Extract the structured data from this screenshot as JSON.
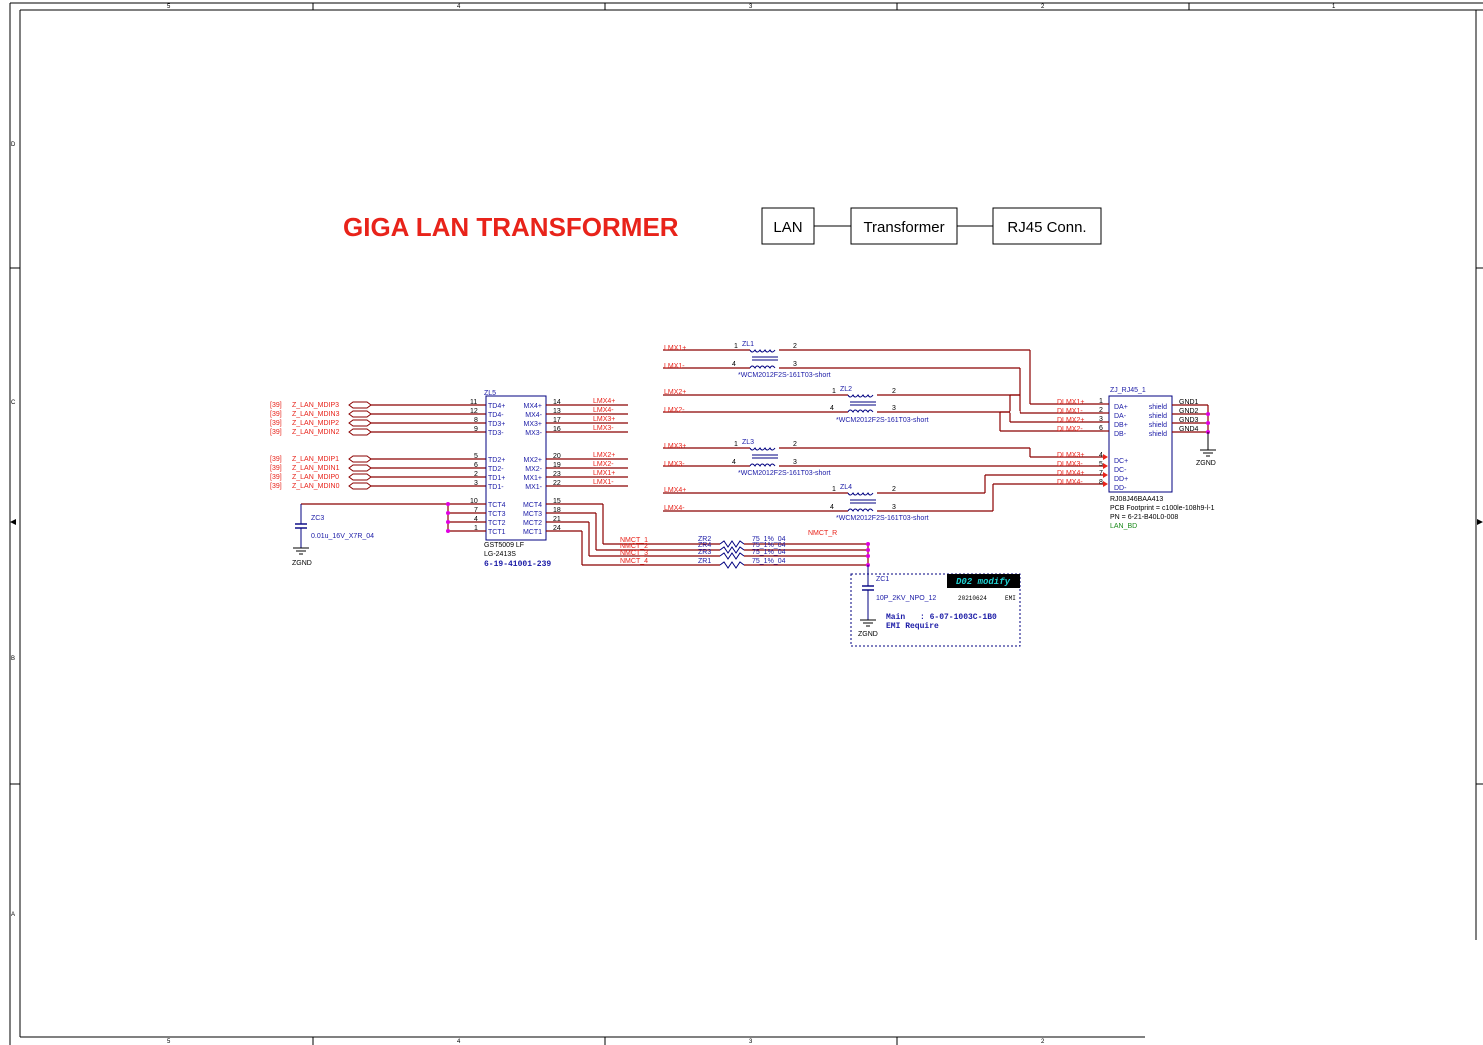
{
  "frame": {
    "top_cols": [
      "5",
      "4",
      "3",
      "2",
      "1"
    ],
    "bottom_cols": [
      "5",
      "4",
      "3",
      "2"
    ],
    "rows": [
      "D",
      "C",
      "B",
      "A"
    ]
  },
  "title": "GIGA LAN TRANSFORMER",
  "block_diagram": [
    "LAN",
    "Transformer",
    "RJ45 Conn."
  ],
  "zl5": {
    "ref": "ZL5",
    "part": "GST5009 LF",
    "alt_part": "LG-2413S",
    "pn": "6-19-41001-239",
    "left_pins": [
      {
        "num": "11",
        "name": "TD4+"
      },
      {
        "num": "12",
        "name": "TD4-"
      },
      {
        "num": "8",
        "name": "TD3+"
      },
      {
        "num": "9",
        "name": "TD3-"
      },
      {
        "num": "5",
        "name": "TD2+"
      },
      {
        "num": "6",
        "name": "TD2-"
      },
      {
        "num": "2",
        "name": "TD1+"
      },
      {
        "num": "3",
        "name": "TD1-"
      },
      {
        "num": "10",
        "name": "TCT4"
      },
      {
        "num": "7",
        "name": "TCT3"
      },
      {
        "num": "4",
        "name": "TCT2"
      },
      {
        "num": "1",
        "name": "TCT1"
      }
    ],
    "right_pins": [
      {
        "num": "14",
        "name": "MX4+"
      },
      {
        "num": "13",
        "name": "MX4-"
      },
      {
        "num": "17",
        "name": "MX3+"
      },
      {
        "num": "16",
        "name": "MX3-"
      },
      {
        "num": "20",
        "name": "MX2+"
      },
      {
        "num": "19",
        "name": "MX2-"
      },
      {
        "num": "23",
        "name": "MX1+"
      },
      {
        "num": "22",
        "name": "MX1-"
      },
      {
        "num": "15",
        "name": "MCT4"
      },
      {
        "num": "18",
        "name": "MCT3"
      },
      {
        "num": "21",
        "name": "MCT2"
      },
      {
        "num": "24",
        "name": "MCT1"
      }
    ]
  },
  "mdi_ports": [
    {
      "sheet": "[39]",
      "net": "Z_LAN_MDIP3"
    },
    {
      "sheet": "[39]",
      "net": "Z_LAN_MDIN3"
    },
    {
      "sheet": "[39]",
      "net": "Z_LAN_MDIP2"
    },
    {
      "sheet": "[39]",
      "net": "Z_LAN_MDIN2"
    },
    {
      "sheet": "[39]",
      "net": "Z_LAN_MDIP1"
    },
    {
      "sheet": "[39]",
      "net": "Z_LAN_MDIN1"
    },
    {
      "sheet": "[39]",
      "net": "Z_LAN_MDIP0"
    },
    {
      "sheet": "[39]",
      "net": "Z_LAN_MDIN0"
    }
  ],
  "zl5_right_nets": [
    "LMX4+",
    "LMX4-",
    "LMX3+",
    "LMX3-",
    "LMX2+",
    "LMX2-",
    "LMX1+",
    "LMX1-"
  ],
  "zc3": {
    "ref": "ZC3",
    "value": "0.01u_16V_X7R_04",
    "gnd": "ZGND"
  },
  "chokes": [
    {
      "ref": "ZL1",
      "in_p": "LMX1+",
      "in_n": "LMX1-",
      "pins": [
        "1",
        "4",
        "2",
        "3"
      ],
      "part": "*WCM2012F2S-161T03-short"
    },
    {
      "ref": "ZL2",
      "in_p": "LMX2+",
      "in_n": "LMX2-",
      "pins": [
        "1",
        "4",
        "2",
        "3"
      ],
      "part": "*WCM2012F2S-161T03-short"
    },
    {
      "ref": "ZL3",
      "in_p": "LMX3+",
      "in_n": "LMX3-",
      "pins": [
        "1",
        "4",
        "2",
        "3"
      ],
      "part": "*WCM2012F2S-161T03-short"
    },
    {
      "ref": "ZL4",
      "in_p": "LMX4+",
      "in_n": "LMX4-",
      "pins": [
        "1",
        "4",
        "2",
        "3"
      ],
      "part": "*WCM2012F2S-161T03-short"
    }
  ],
  "nmct": [
    {
      "net": "NMCT_1",
      "res": "ZR2",
      "value": "75_1%_04"
    },
    {
      "net": "NMCT_2",
      "res": "ZR4",
      "value": "75_1%_04"
    },
    {
      "net": "NMCT_3",
      "res": "ZR3",
      "value": "75_1%_04"
    },
    {
      "net": "NMCT_4",
      "res": "ZR1",
      "value": "75_1%_04"
    }
  ],
  "nmct_r": "NMCT_R",
  "zc1": {
    "ref": "ZC1",
    "value": "10P_2KV_NPO_12",
    "gnd": "ZGND"
  },
  "modify_box": {
    "tag": "D02 modify",
    "date": "20210624",
    "dept": "EMI",
    "main_label": "Main",
    "main_pn": ": 6-07-1003C-1B0",
    "note": "EMI Require"
  },
  "rj45": {
    "ref": "ZJ_RJ45_1",
    "pins_left": [
      {
        "net": "DLMX1+",
        "num": "1",
        "name": "DA+"
      },
      {
        "net": "DLMX1-",
        "num": "2",
        "name": "DA-"
      },
      {
        "net": "DLMX2+",
        "num": "3",
        "name": "DB+"
      },
      {
        "net": "DLMX2-",
        "num": "6",
        "name": "DB-"
      },
      {
        "net": "DLMX3+",
        "num": "4",
        "name": "DC+"
      },
      {
        "net": "DLMX3-",
        "num": "5",
        "name": "DC-"
      },
      {
        "net": "DLMX4+",
        "num": "7",
        "name": "DD+"
      },
      {
        "net": "DLMX4-",
        "num": "8",
        "name": "DD-"
      }
    ],
    "shield": [
      "shield",
      "shield",
      "shield",
      "shield"
    ],
    "gnd_nets": [
      "GND1",
      "GND2",
      "GND3",
      "GND4"
    ],
    "gnd": "ZGND",
    "part": "RJ08J46BAA413",
    "footprint": "PCB Footprint = c100le-108h9-l-1",
    "pn": "PN = 6-21-B40L0-008",
    "board": "LAN_BD"
  },
  "colors": {
    "net_label": "#e8231a",
    "wire": "#8b0000",
    "component": "#000080",
    "junction": "#e000e0",
    "title": "#e8231a"
  }
}
